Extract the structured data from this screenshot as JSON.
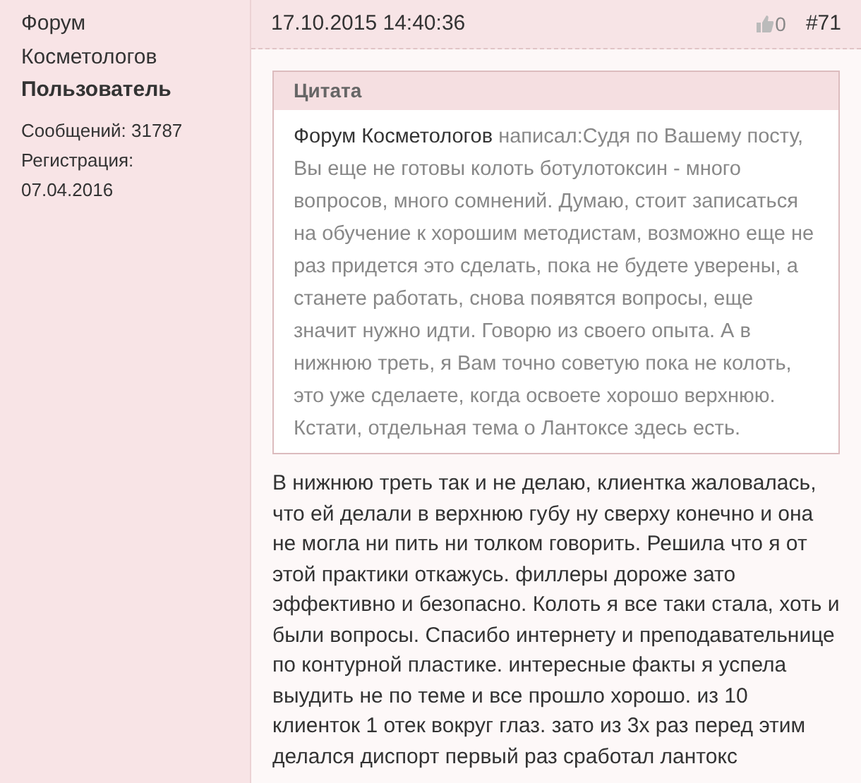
{
  "author": {
    "name": "Форум Косметологов",
    "role": "Пользователь",
    "posts": "Сообщений: 31787",
    "registration_label": "Регистрация:",
    "registration_date": "07.04.2016"
  },
  "post": {
    "date": "17.10.2015 14:40:36",
    "likes": "0",
    "number": "#71",
    "quote": {
      "title": "Цитата",
      "author": "Форум Косметологов",
      "text": "написал:Судя по Вашему посту, Вы еще не готовы колоть ботулотоксин - много вопросов, много сомнений. Думаю, стоит записаться на обучение к хорошим методистам, возможно еще не раз придется это сделать, пока не будете уверены, а станете работать, снова появятся вопросы, еще значит нужно идти. Говорю из своего опыта. А в нижнюю треть, я Вам точно советую пока не колоть, это уже сделаете, когда освоете хорошо верхнюю. Кстати, отдельная тема о Лантоксе здесь есть."
    },
    "text": "В нижнюю треть так и не делаю, клиентка жаловалась, что ей делали в верхнюю губу ну сверху конечно и она не могла ни пить ни толком говорить. Решила что я от этой практики откажусь. филлеры дороже зато эффективно и безопасно. Колоть я все таки стала, хоть и были вопросы. Спасибо интернету и преподавательнице по контурной пластике. интересные факты я успела выудить не по теме и все прошло хорошо. из 10 клиенток 1 отек вокруг глаз. зато из 3х раз перед этим делался диспорт первый раз сработал лантокс"
  }
}
